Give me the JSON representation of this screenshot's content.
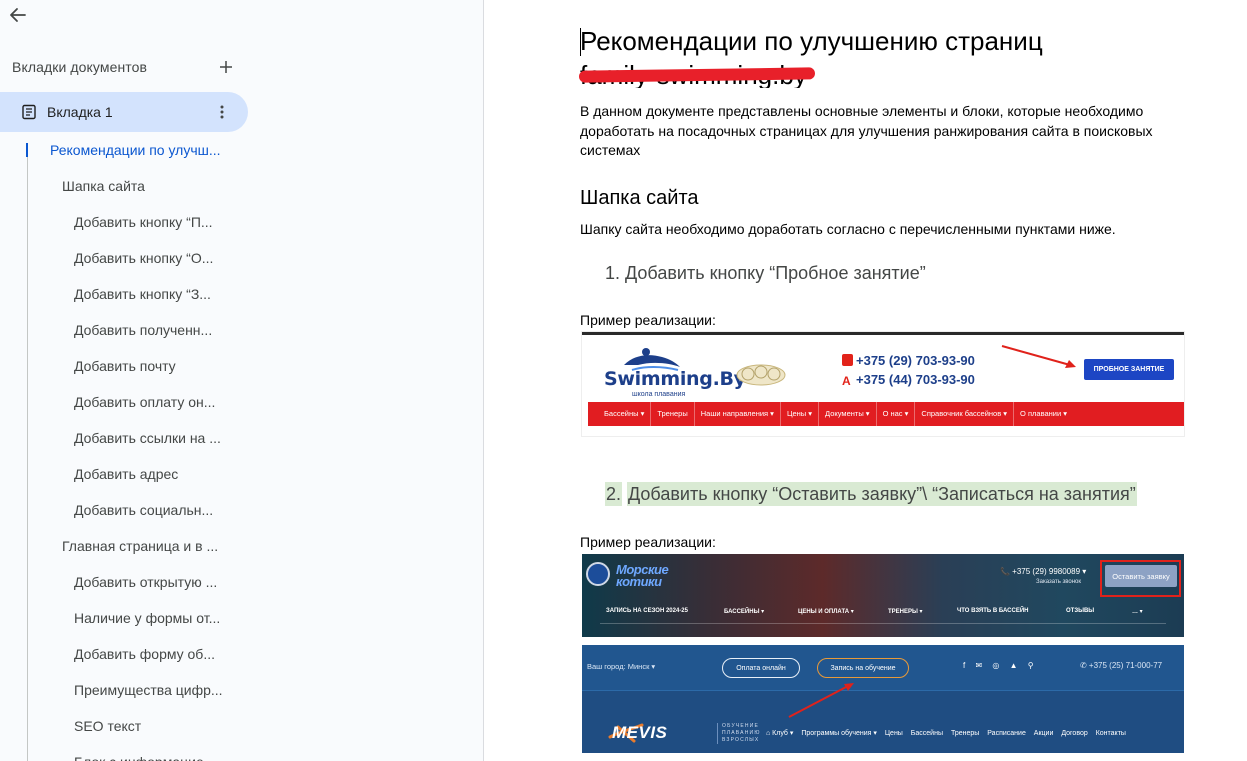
{
  "sidebar": {
    "tabs_title": "Вкладки документов",
    "active_tab": "Вкладка 1",
    "outline": [
      {
        "level": 1,
        "text": "Рекомендации по улучш..."
      },
      {
        "level": 2,
        "text": "Шапка сайта"
      },
      {
        "level": 3,
        "text": "Добавить кнопку “П..."
      },
      {
        "level": 3,
        "text": "Добавить кнопку “О..."
      },
      {
        "level": 3,
        "text": "Добавить кнопку “З..."
      },
      {
        "level": 3,
        "text": "Добавить полученн..."
      },
      {
        "level": 3,
        "text": "Добавить почту"
      },
      {
        "level": 3,
        "text": "Добавить оплату он..."
      },
      {
        "level": 3,
        "text": "Добавить ссылки на ..."
      },
      {
        "level": 3,
        "text": "Добавить адрес"
      },
      {
        "level": 3,
        "text": "Добавить социальн..."
      },
      {
        "level": 2,
        "text": "Главная страница и в ..."
      },
      {
        "level": 3,
        "text": "Добавить открытую ..."
      },
      {
        "level": 3,
        "text": "Наличие у формы от..."
      },
      {
        "level": 3,
        "text": "Добавить форму об..."
      },
      {
        "level": 3,
        "text": "Преимущества цифр..."
      },
      {
        "level": 3,
        "text": "SEO текст"
      },
      {
        "level": 3,
        "text": "Блок с информацие..."
      }
    ]
  },
  "document": {
    "title": "Рекомендации по улучшению страниц",
    "subtitle_redacted": "family-swimming.by",
    "intro": "В данном документе представлены основные элементы и блоки, которые необходимо доработать на посадочных страницах для улучшения ранжирования сайта в поисковых системах",
    "section_heading": "Шапка сайта",
    "section_text": "Шапку сайта необходимо доработать согласно с перечисленными пунктами ниже.",
    "list": [
      {
        "num": "1.",
        "text": "Добавить кнопку “Пробное занятие”"
      },
      {
        "num": "2.",
        "text": "Добавить кнопку “Оставить заявку”\\ “Записаться на занятия”"
      }
    ],
    "example_caption": "Пример реализации:"
  },
  "screenshot1": {
    "brand": "Swimming.By",
    "brand_sub": "школа плавания",
    "phones": [
      "+375 (29) 703-93-90",
      "+375 (44) 703-93-90"
    ],
    "cta": "ПРОБНОЕ ЗАНЯТИЕ",
    "nav": [
      "Бассейны ▾",
      "Тренеры",
      "Наши направления ▾",
      "Цены ▾",
      "Документы ▾",
      "О нас ▾",
      "Справочник бассейнов ▾",
      "О плавании ▾"
    ]
  },
  "screenshot2": {
    "brand": "Морские котики",
    "phone": "📞 +375 (29) 9980089 ▾",
    "call_link": "Заказать звонок",
    "cta": "Оставить заявку",
    "nav": [
      "ЗАПИСЬ НА СЕЗОН 2024-25",
      "БАССЕЙНЫ ▾",
      "ЦЕНЫ И ОПЛАТА ▾",
      "ТРЕНЕРЫ ▾",
      "ЧТО ВЗЯТЬ В БАССЕЙН",
      "ОТЗЫВЫ",
      "… ▾"
    ]
  },
  "screenshot3": {
    "city": "Ваш город: Минск ▾",
    "pay_button": "Оплата онлайн",
    "enroll_button": "Запись на обучение",
    "social": "f ✉ ◎ ▲ ⚲",
    "phone": "✆ +375 (25) 71-000-77",
    "brand": "MEVIS",
    "brand_sub": "ОБУЧЕНИЕ ПЛАВАНИЮ ВЗРОСЛЫХ",
    "nav": [
      "⌂ Клуб ▾",
      "Программы обучения ▾",
      "Цены",
      "Бассейны",
      "Тренеры",
      "Расписание",
      "Акции",
      "Договор",
      "Контакты"
    ]
  },
  "colors": {
    "accent_blue": "#0b57d0",
    "active_tab_bg": "#d3e3fd",
    "highlight_green": "#d9ead3",
    "redact_red": "#e8202a",
    "annotation_red": "#e0221b"
  }
}
